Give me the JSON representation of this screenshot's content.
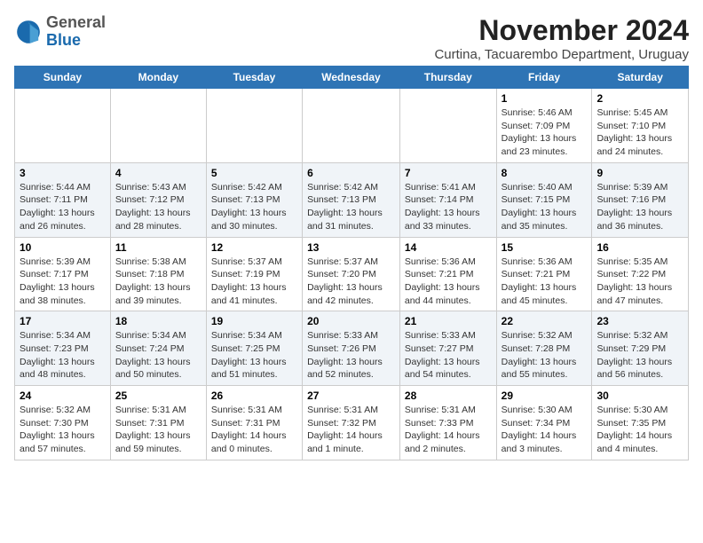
{
  "logo": {
    "general": "General",
    "blue": "Blue"
  },
  "title": "November 2024",
  "subtitle": "Curtina, Tacuarembo Department, Uruguay",
  "days_of_week": [
    "Sunday",
    "Monday",
    "Tuesday",
    "Wednesday",
    "Thursday",
    "Friday",
    "Saturday"
  ],
  "weeks": [
    [
      {
        "day": "",
        "content": ""
      },
      {
        "day": "",
        "content": ""
      },
      {
        "day": "",
        "content": ""
      },
      {
        "day": "",
        "content": ""
      },
      {
        "day": "",
        "content": ""
      },
      {
        "day": "1",
        "content": "Sunrise: 5:46 AM\nSunset: 7:09 PM\nDaylight: 13 hours\nand 23 minutes."
      },
      {
        "day": "2",
        "content": "Sunrise: 5:45 AM\nSunset: 7:10 PM\nDaylight: 13 hours\nand 24 minutes."
      }
    ],
    [
      {
        "day": "3",
        "content": "Sunrise: 5:44 AM\nSunset: 7:11 PM\nDaylight: 13 hours\nand 26 minutes."
      },
      {
        "day": "4",
        "content": "Sunrise: 5:43 AM\nSunset: 7:12 PM\nDaylight: 13 hours\nand 28 minutes."
      },
      {
        "day": "5",
        "content": "Sunrise: 5:42 AM\nSunset: 7:13 PM\nDaylight: 13 hours\nand 30 minutes."
      },
      {
        "day": "6",
        "content": "Sunrise: 5:42 AM\nSunset: 7:13 PM\nDaylight: 13 hours\nand 31 minutes."
      },
      {
        "day": "7",
        "content": "Sunrise: 5:41 AM\nSunset: 7:14 PM\nDaylight: 13 hours\nand 33 minutes."
      },
      {
        "day": "8",
        "content": "Sunrise: 5:40 AM\nSunset: 7:15 PM\nDaylight: 13 hours\nand 35 minutes."
      },
      {
        "day": "9",
        "content": "Sunrise: 5:39 AM\nSunset: 7:16 PM\nDaylight: 13 hours\nand 36 minutes."
      }
    ],
    [
      {
        "day": "10",
        "content": "Sunrise: 5:39 AM\nSunset: 7:17 PM\nDaylight: 13 hours\nand 38 minutes."
      },
      {
        "day": "11",
        "content": "Sunrise: 5:38 AM\nSunset: 7:18 PM\nDaylight: 13 hours\nand 39 minutes."
      },
      {
        "day": "12",
        "content": "Sunrise: 5:37 AM\nSunset: 7:19 PM\nDaylight: 13 hours\nand 41 minutes."
      },
      {
        "day": "13",
        "content": "Sunrise: 5:37 AM\nSunset: 7:20 PM\nDaylight: 13 hours\nand 42 minutes."
      },
      {
        "day": "14",
        "content": "Sunrise: 5:36 AM\nSunset: 7:21 PM\nDaylight: 13 hours\nand 44 minutes."
      },
      {
        "day": "15",
        "content": "Sunrise: 5:36 AM\nSunset: 7:21 PM\nDaylight: 13 hours\nand 45 minutes."
      },
      {
        "day": "16",
        "content": "Sunrise: 5:35 AM\nSunset: 7:22 PM\nDaylight: 13 hours\nand 47 minutes."
      }
    ],
    [
      {
        "day": "17",
        "content": "Sunrise: 5:34 AM\nSunset: 7:23 PM\nDaylight: 13 hours\nand 48 minutes."
      },
      {
        "day": "18",
        "content": "Sunrise: 5:34 AM\nSunset: 7:24 PM\nDaylight: 13 hours\nand 50 minutes."
      },
      {
        "day": "19",
        "content": "Sunrise: 5:34 AM\nSunset: 7:25 PM\nDaylight: 13 hours\nand 51 minutes."
      },
      {
        "day": "20",
        "content": "Sunrise: 5:33 AM\nSunset: 7:26 PM\nDaylight: 13 hours\nand 52 minutes."
      },
      {
        "day": "21",
        "content": "Sunrise: 5:33 AM\nSunset: 7:27 PM\nDaylight: 13 hours\nand 54 minutes."
      },
      {
        "day": "22",
        "content": "Sunrise: 5:32 AM\nSunset: 7:28 PM\nDaylight: 13 hours\nand 55 minutes."
      },
      {
        "day": "23",
        "content": "Sunrise: 5:32 AM\nSunset: 7:29 PM\nDaylight: 13 hours\nand 56 minutes."
      }
    ],
    [
      {
        "day": "24",
        "content": "Sunrise: 5:32 AM\nSunset: 7:30 PM\nDaylight: 13 hours\nand 57 minutes."
      },
      {
        "day": "25",
        "content": "Sunrise: 5:31 AM\nSunset: 7:31 PM\nDaylight: 13 hours\nand 59 minutes."
      },
      {
        "day": "26",
        "content": "Sunrise: 5:31 AM\nSunset: 7:31 PM\nDaylight: 14 hours\nand 0 minutes."
      },
      {
        "day": "27",
        "content": "Sunrise: 5:31 AM\nSunset: 7:32 PM\nDaylight: 14 hours\nand 1 minute."
      },
      {
        "day": "28",
        "content": "Sunrise: 5:31 AM\nSunset: 7:33 PM\nDaylight: 14 hours\nand 2 minutes."
      },
      {
        "day": "29",
        "content": "Sunrise: 5:30 AM\nSunset: 7:34 PM\nDaylight: 14 hours\nand 3 minutes."
      },
      {
        "day": "30",
        "content": "Sunrise: 5:30 AM\nSunset: 7:35 PM\nDaylight: 14 hours\nand 4 minutes."
      }
    ]
  ]
}
